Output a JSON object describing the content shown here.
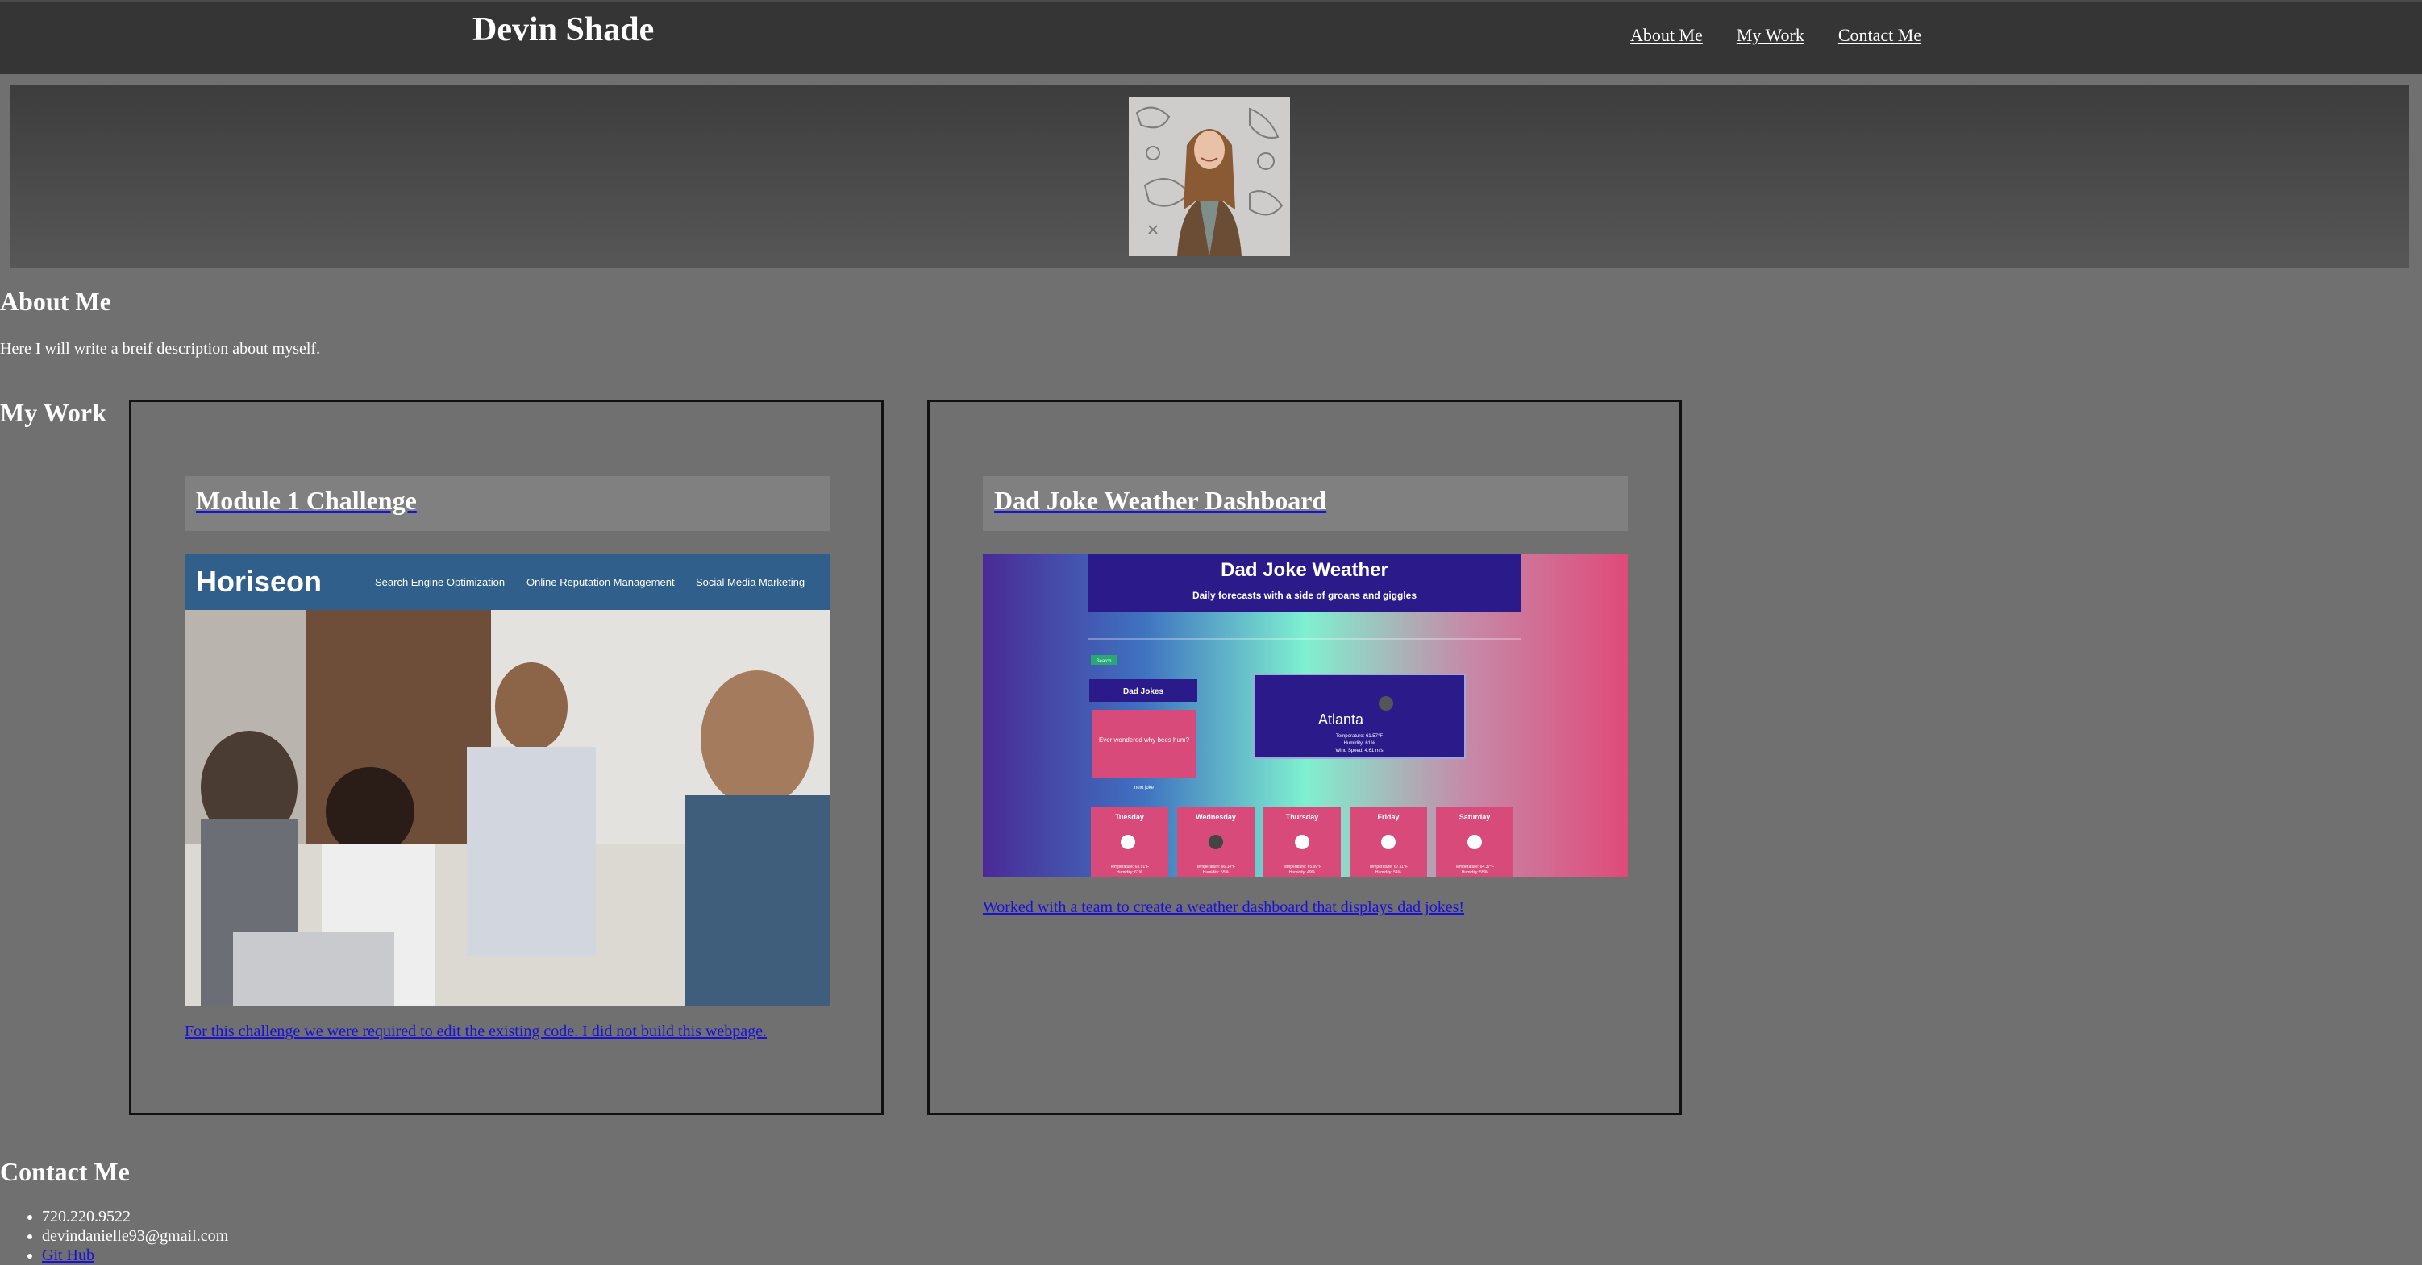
{
  "header": {
    "title": "Devin Shade",
    "nav": [
      "About Me",
      "My Work",
      "Contact Me"
    ]
  },
  "about": {
    "heading": "About Me",
    "text": "Here I will write a breif description about myself."
  },
  "work": {
    "heading": "My Work",
    "projects": [
      {
        "title": "Module 1 Challenge",
        "description": "For this challenge we were required to edit the existing code. I did not build this webpage.",
        "screenshot": {
          "logo": "Horiseon",
          "nav": [
            "Search Engine Optimization",
            "Online Reputation Management",
            "Social Media Marketing"
          ]
        }
      },
      {
        "title": "Dad Joke Weather Dashboard",
        "description": "Worked with a team to create a weather dashboard that displays dad jokes!",
        "screenshot": {
          "title": "Dad Joke Weather",
          "subtitle": "Daily forecasts with a side of groans and giggles",
          "search": "Search",
          "jokes_label": "Dad Jokes",
          "joke": "Ever wondered why bees hum?",
          "next_joke": "next joke",
          "city": "Atlanta",
          "current": [
            "Temperature: 61.57°F",
            "Humidity: 61%",
            "Wind Speed: 4.61 m/s"
          ],
          "days": [
            "Tuesday",
            "Wednesday",
            "Thursday",
            "Friday",
            "Saturday"
          ],
          "day_temps": [
            "Temperature: 63.91°F",
            "Temperature: 66.14°F",
            "Temperature: 65.99°F",
            "Temperature: 67.11°F",
            "Temperature: 64.37°F"
          ],
          "day_humidity": [
            "Humidity: 61%",
            "Humidity: 55%",
            "Humidity: 49%",
            "Humidity: 54%",
            "Humidity: 55%"
          ]
        }
      }
    ]
  },
  "contact": {
    "heading": "Contact Me",
    "phone": "720.220.9522",
    "email": "devindanielle93@gmail.com",
    "github": "Git Hub"
  }
}
